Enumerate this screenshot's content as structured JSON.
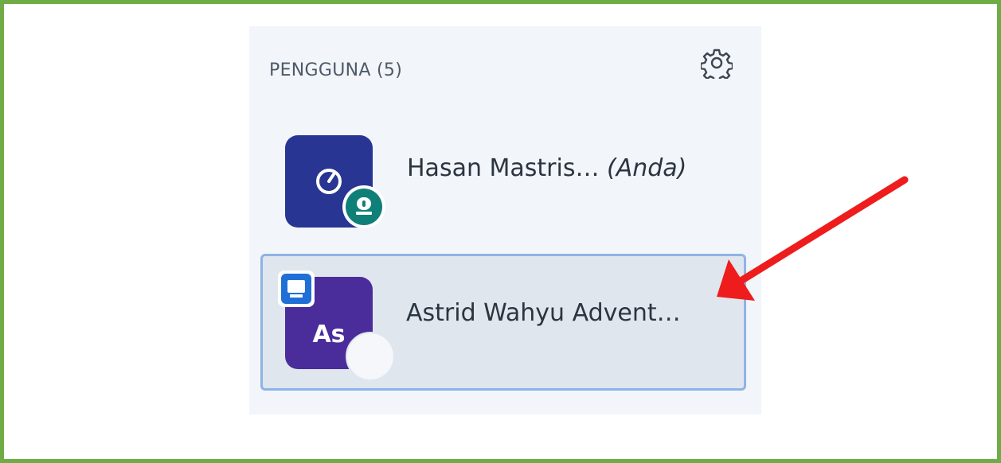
{
  "panel": {
    "title": "PENGGUNA (5)",
    "settings_icon": "gear-icon"
  },
  "users": [
    {
      "name": "Hasan Mastris…",
      "you_tag": "(Anda)",
      "avatar_icon": "clock-icon",
      "avatar_color": "#283593",
      "badge": "presenter-icon",
      "badge_color": "#0f8077",
      "selected": false
    },
    {
      "name": "Astrid Wahyu Advent…",
      "initials": "As",
      "avatar_color": "#4a2c9b",
      "badge": "screen-share-icon",
      "badge_color": "#1f6fd6",
      "selected": true
    }
  ],
  "colors": {
    "frame": "#6fac46",
    "panel_bg": "#f2f5f9",
    "selected_bg": "#dfe6ee",
    "selected_border": "#8fb3e6",
    "arrow": "#ee1c1c"
  }
}
